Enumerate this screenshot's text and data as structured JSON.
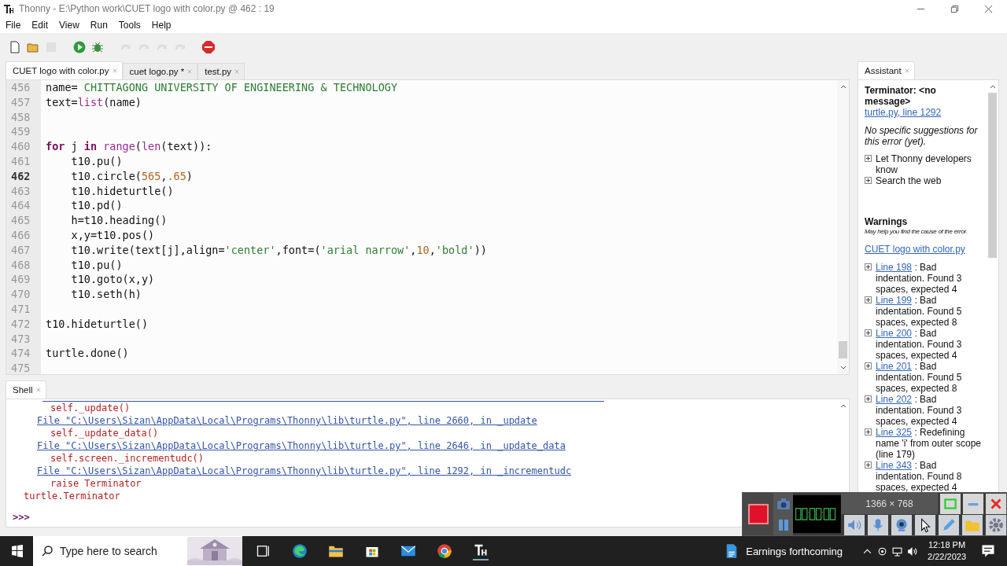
{
  "window": {
    "title": "Thonny  -  E:\\Python work\\CUET logo with color.py  @  462 : 19"
  },
  "menu": [
    "File",
    "Edit",
    "View",
    "Run",
    "Tools",
    "Help"
  ],
  "toolbar": [
    {
      "kind": "new",
      "disabled": false
    },
    {
      "kind": "open",
      "disabled": false
    },
    {
      "kind": "save",
      "disabled": true
    },
    {
      "kind": "run",
      "disabled": false
    },
    {
      "kind": "debug",
      "disabled": false
    },
    {
      "kind": "step-over",
      "disabled": true
    },
    {
      "kind": "step-into",
      "disabled": true
    },
    {
      "kind": "step-out",
      "disabled": true
    },
    {
      "kind": "resume",
      "disabled": true
    },
    {
      "kind": "stop",
      "disabled": false
    }
  ],
  "editor_tabs": [
    {
      "label": "CUET logo with color.py",
      "selected": true
    },
    {
      "label": "cuet logo.py *",
      "selected": false
    },
    {
      "label": "test.py",
      "selected": false
    }
  ],
  "editor": {
    "lines": [
      {
        "number": "456",
        "current": false,
        "tokens": [
          {
            "kind": "plain",
            "text": "name= "
          },
          {
            "kind": "str",
            "text": "CHITTAGONG UNIVERSITY OF ENGINEERING & TECHNOLOGY"
          }
        ]
      },
      {
        "number": "457",
        "current": false,
        "tokens": [
          {
            "kind": "plain",
            "text": "text="
          },
          {
            "kind": "builtin",
            "text": "list"
          },
          {
            "kind": "plain",
            "text": "(name)"
          }
        ]
      },
      {
        "number": "458",
        "current": false
      },
      {
        "number": "459",
        "current": false
      },
      {
        "number": "460",
        "current": false,
        "tokens": [
          {
            "kind": "kw",
            "text": "for"
          },
          {
            "kind": "plain",
            "text": " j "
          },
          {
            "kind": "kw",
            "text": "in"
          },
          {
            "kind": "builtin",
            "text": " range"
          },
          {
            "kind": "plain",
            "text": "("
          },
          {
            "kind": "builtin",
            "text": "len"
          },
          {
            "kind": "plain",
            "text": "(text)):"
          }
        ]
      },
      {
        "number": "461",
        "current": false,
        "tokens": [
          {
            "kind": "plain",
            "text": "    t10.pu()"
          }
        ]
      },
      {
        "number": "462",
        "current": true,
        "tokens": [
          {
            "kind": "plain",
            "text": "    t10.circle("
          },
          {
            "kind": "num",
            "text": "565"
          },
          {
            "kind": "plain",
            "text": ","
          },
          {
            "kind": "num",
            "text": ".65"
          },
          {
            "kind": "plain",
            "text": ")"
          }
        ]
      },
      {
        "number": "463",
        "current": false,
        "tokens": [
          {
            "kind": "plain",
            "text": "    t10.hideturtle()"
          }
        ]
      },
      {
        "number": "464",
        "current": false,
        "tokens": [
          {
            "kind": "plain",
            "text": "    t10.pd()"
          }
        ]
      },
      {
        "number": "465",
        "current": false,
        "tokens": [
          {
            "kind": "plain",
            "text": "    h=t10.heading()"
          }
        ]
      },
      {
        "number": "466",
        "current": false,
        "tokens": [
          {
            "kind": "plain",
            "text": "    x,y=t10.pos()"
          }
        ]
      },
      {
        "number": "467",
        "current": false,
        "tokens": [
          {
            "kind": "plain",
            "text": "    t10.write(text[j],align="
          },
          {
            "kind": "str",
            "text": "'center'"
          },
          {
            "kind": "plain",
            "text": ",font=("
          },
          {
            "kind": "str",
            "text": "'arial narrow'"
          },
          {
            "kind": "plain",
            "text": ","
          },
          {
            "kind": "num",
            "text": "10"
          },
          {
            "kind": "plain",
            "text": ","
          },
          {
            "kind": "str",
            "text": "'bold'"
          },
          {
            "kind": "plain",
            "text": "))"
          }
        ]
      },
      {
        "number": "468",
        "current": false,
        "tokens": [
          {
            "kind": "plain",
            "text": "    t10.pu()"
          }
        ]
      },
      {
        "number": "469",
        "current": false,
        "tokens": [
          {
            "kind": "plain",
            "text": "    t10.goto(x,y)"
          }
        ]
      },
      {
        "number": "470",
        "current": false,
        "tokens": [
          {
            "kind": "plain",
            "text": "    t10.seth(h)"
          }
        ]
      },
      {
        "number": "471",
        "current": false
      },
      {
        "number": "472",
        "current": false,
        "tokens": [
          {
            "kind": "plain",
            "text": "t10.hideturtle()"
          }
        ]
      },
      {
        "number": "473",
        "current": false
      },
      {
        "number": "474",
        "current": false,
        "tokens": [
          {
            "kind": "plain",
            "text": "turtle.done()"
          }
        ]
      },
      {
        "number": "475",
        "current": false
      }
    ]
  },
  "shell": {
    "tab": "Shell",
    "lines": [
      {
        "kind": "code",
        "text": "self._update()"
      },
      {
        "kind": "link",
        "text": "File \"C:\\Users\\Sizan\\AppData\\Local\\Programs\\Thonny\\lib\\turtle.py\", line 2660, in _update"
      },
      {
        "kind": "code",
        "text": "self._update_data()"
      },
      {
        "kind": "link",
        "text": "File \"C:\\Users\\Sizan\\AppData\\Local\\Programs\\Thonny\\lib\\turtle.py\", line 2646, in _update_data"
      },
      {
        "kind": "code",
        "text": "self.screen._incrementudc()"
      },
      {
        "kind": "link",
        "text": "File \"C:\\Users\\Sizan\\AppData\\Local\\Programs\\Thonny\\lib\\turtle.py\", line 1292, in _incrementudc"
      },
      {
        "kind": "code",
        "text": "raise Terminator"
      },
      {
        "kind": "error",
        "text": "turtle.Terminator"
      }
    ],
    "prompt": ">>>"
  },
  "assistant": {
    "tab": "Assistant",
    "title": "Terminator: <no message>",
    "location": "turtle.py, line 1292",
    "note": "No specific suggestions for this error (yet).",
    "actions": [
      "Let Thonny developers know",
      "Search the web"
    ],
    "warnings_heading": "Warnings",
    "warnings_sub": "May help you find the cause of the error.",
    "file": "CUET logo with color.py",
    "warnings": [
      {
        "line": "Line 198",
        "text": " : Bad indentation. Found 3 spaces, expected 4"
      },
      {
        "line": "Line 199",
        "text": " : Bad indentation. Found 5 spaces, expected 8"
      },
      {
        "line": "Line 200",
        "text": " : Bad indentation. Found 3 spaces, expected 4"
      },
      {
        "line": "Line 201",
        "text": " : Bad indentation. Found 5 spaces, expected 8"
      },
      {
        "line": "Line 202",
        "text": " : Bad indentation. Found 3 spaces, expected 4"
      },
      {
        "line": "Line 325",
        "text": " : Redefining name 'i' from outer scope (line 179)"
      },
      {
        "line": "Line 343",
        "text": " : Bad indentation. Found 8 spaces, expected 4"
      }
    ]
  },
  "recorder": {
    "resolution": "1366 × 768"
  },
  "taskbar": {
    "search_placeholder": "Type here to search",
    "news": "Earnings forthcoming",
    "time": "12:18 PM",
    "date": "2/22/2023"
  }
}
